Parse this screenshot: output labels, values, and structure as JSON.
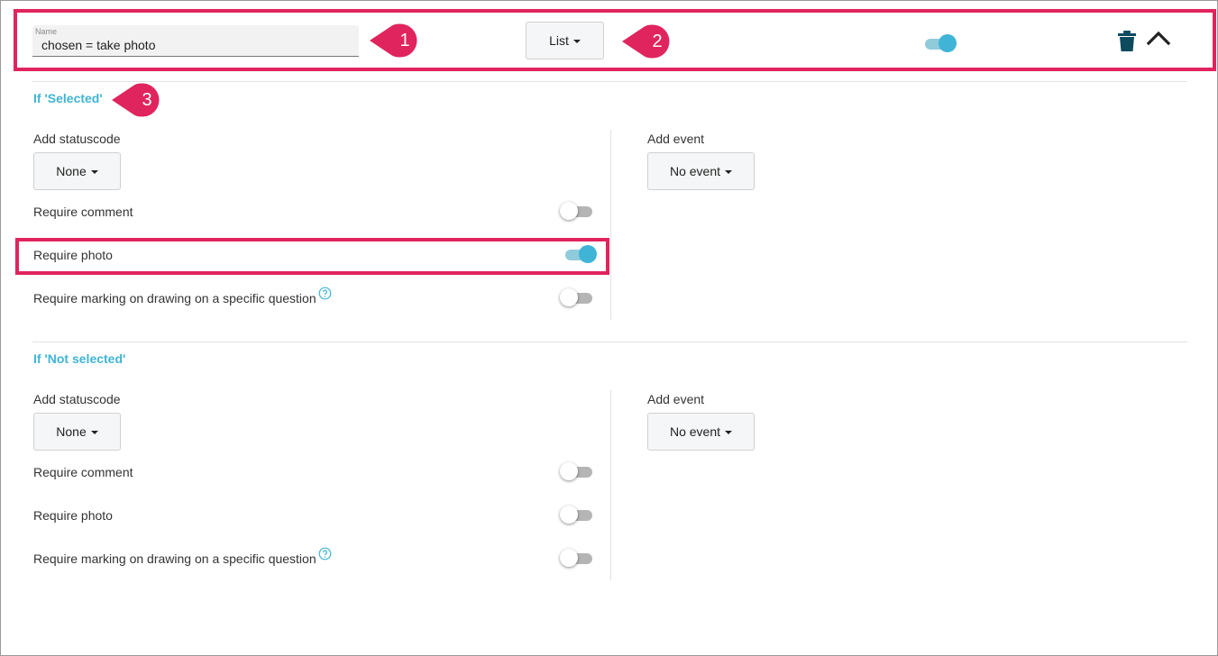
{
  "header": {
    "name_label": "Name",
    "name_value": "chosen = take photo",
    "type_button": "List",
    "enabled": true
  },
  "callouts": [
    "1",
    "2",
    "3"
  ],
  "sections": [
    {
      "title": "If 'Selected'",
      "statuscode_label": "Add statuscode",
      "statuscode_value": "None",
      "event_label": "Add event",
      "event_value": "No event",
      "require_comment_label": "Require comment",
      "require_comment": false,
      "require_photo_label": "Require photo",
      "require_photo": true,
      "require_marking_label": "Require marking on drawing on a specific question",
      "require_marking": false
    },
    {
      "title": "If 'Not selected'",
      "statuscode_label": "Add statuscode",
      "statuscode_value": "None",
      "event_label": "Add event",
      "event_value": "No event",
      "require_comment_label": "Require comment",
      "require_comment": false,
      "require_photo_label": "Require photo",
      "require_photo": false,
      "require_marking_label": "Require marking on drawing on a specific question",
      "require_marking": false
    }
  ],
  "colors": {
    "accent": "#40b4d6",
    "highlight": "#e0245e",
    "icon_dark": "#0d4a5e"
  },
  "icons": [
    "trash-icon",
    "chevron-up-icon",
    "help-circle-icon",
    "caret-down-icon"
  ]
}
